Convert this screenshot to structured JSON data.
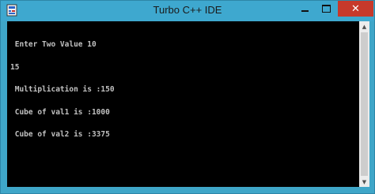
{
  "window": {
    "title": "Turbo C++ IDE",
    "close_label": "✕",
    "app_icon": "turbo-cpp-app-icon"
  },
  "console": {
    "lines": [
      " Enter Two Value 10",
      "15",
      " Multiplication is :150",
      " Cube of val1 is :1000",
      " Cube of val2 is :3375"
    ]
  },
  "colors": {
    "titlebar": "#3ea8cf",
    "close_button": "#c7392b",
    "console_background": "#000000",
    "console_text": "#c0c0c0"
  }
}
